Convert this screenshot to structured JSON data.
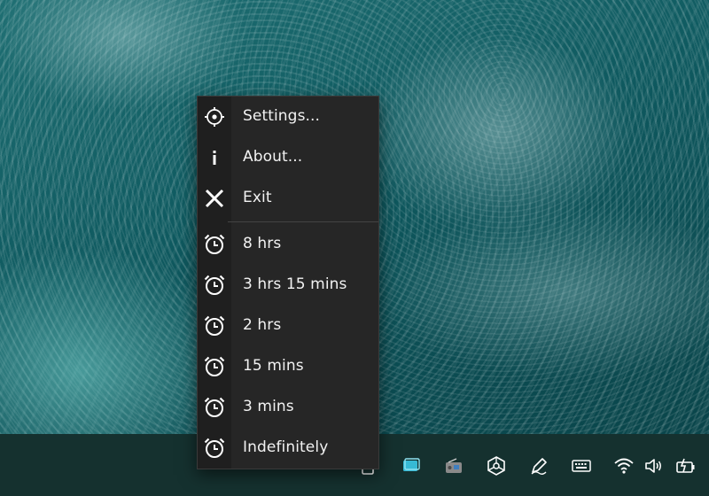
{
  "menu": {
    "items": [
      {
        "label": "Settings...",
        "icon": "gear-icon"
      },
      {
        "label": "About...",
        "icon": "info-icon"
      },
      {
        "label": "Exit",
        "icon": "close-icon"
      },
      {
        "label": "8 hrs",
        "icon": "alarm-clock-icon"
      },
      {
        "label": "3 hrs 15 mins",
        "icon": "alarm-clock-icon"
      },
      {
        "label": "2 hrs",
        "icon": "alarm-clock-icon"
      },
      {
        "label": "15 mins",
        "icon": "alarm-clock-icon"
      },
      {
        "label": "3 mins",
        "icon": "alarm-clock-icon"
      },
      {
        "label": "Indefinitely",
        "icon": "alarm-clock-icon"
      }
    ]
  },
  "taskbar": {
    "tray_icons": [
      "app-window-icon",
      "tablet-icon",
      "radio-icon",
      "network-hub-icon",
      "pen-icon",
      "keyboard-icon",
      "wifi-icon",
      "volume-icon",
      "battery-charging-icon"
    ]
  },
  "colors": {
    "menu_background": "#262626",
    "menu_text": "#f2f2f2",
    "taskbar": "#15312f",
    "accent": "#37b9d4"
  }
}
